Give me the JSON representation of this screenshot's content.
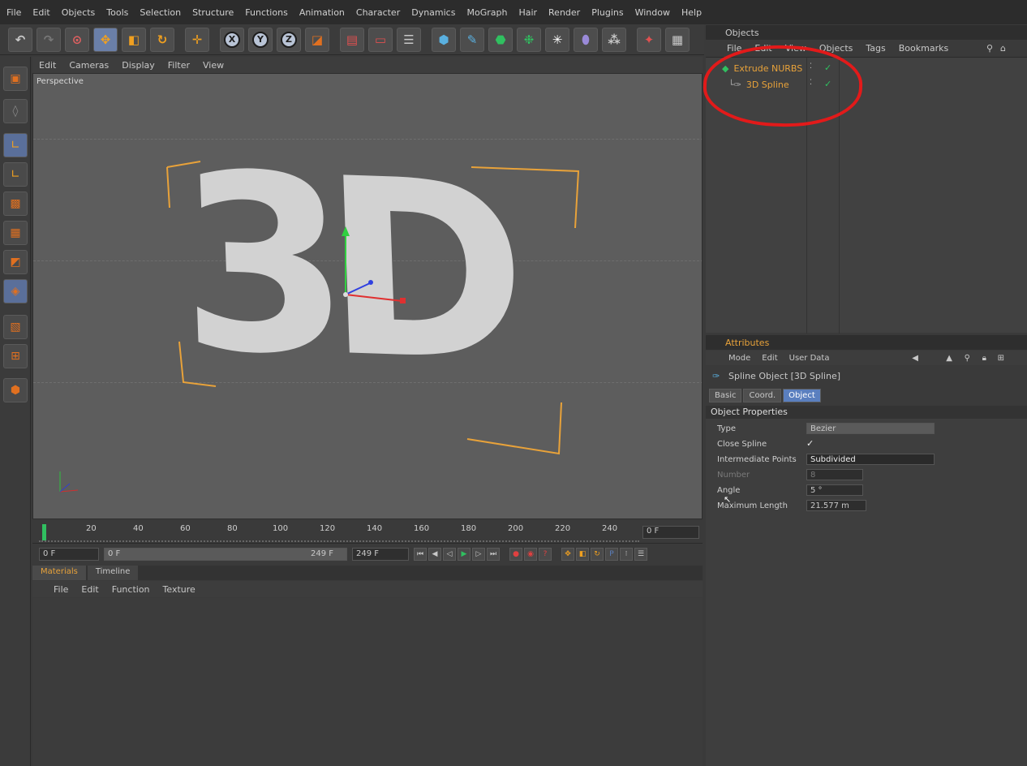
{
  "menubar": [
    "File",
    "Edit",
    "Objects",
    "Tools",
    "Selection",
    "Structure",
    "Functions",
    "Animation",
    "Character",
    "Dynamics",
    "MoGraph",
    "Hair",
    "Render",
    "Plugins",
    "Window",
    "Help"
  ],
  "toolbar": {
    "axis_x": "X",
    "axis_y": "Y",
    "axis_z": "Z"
  },
  "viewport": {
    "menu": [
      "Edit",
      "Cameras",
      "Display",
      "Filter",
      "View"
    ],
    "label": "Perspective",
    "text": "3D"
  },
  "timeline": {
    "ticks": [
      "20",
      "40",
      "60",
      "80",
      "100",
      "120",
      "140",
      "160",
      "180",
      "200",
      "220",
      "240"
    ],
    "current_frame": "0 F",
    "start": "0 F",
    "range_start": "0 F",
    "range_end": "249 F",
    "end": "249 F"
  },
  "materials": {
    "tabs": [
      "Materials",
      "Timeline"
    ],
    "menu": [
      "File",
      "Edit",
      "Function",
      "Texture"
    ]
  },
  "objects_panel": {
    "title": "Objects",
    "menu": [
      "File",
      "Edit",
      "View",
      "Objects",
      "Tags",
      "Bookmarks"
    ],
    "items": [
      {
        "name": "Extrude NURBS"
      },
      {
        "name": "3D Spline"
      }
    ]
  },
  "attributes": {
    "title": "Attributes",
    "mode_menu": [
      "Mode",
      "Edit",
      "User Data"
    ],
    "object_title": "Spline Object [3D Spline]",
    "tabs": [
      "Basic",
      "Coord.",
      "Object"
    ],
    "section": "Object Properties",
    "props": {
      "type_label": "Type",
      "type_value": "Bezier",
      "close_label": "Close Spline",
      "close_value": "✓",
      "inter_label": "Intermediate Points",
      "inter_value": "Subdivided",
      "number_label": "Number",
      "number_value": "8",
      "angle_label": "Angle",
      "angle_value": "5 °",
      "maxlen_label": "Maximum Length",
      "maxlen_value": "21.577 m"
    }
  },
  "colors": {
    "accent": "#e8a23a",
    "highlight": "#e21a1a",
    "selected_tab": "#5a7fbf"
  }
}
